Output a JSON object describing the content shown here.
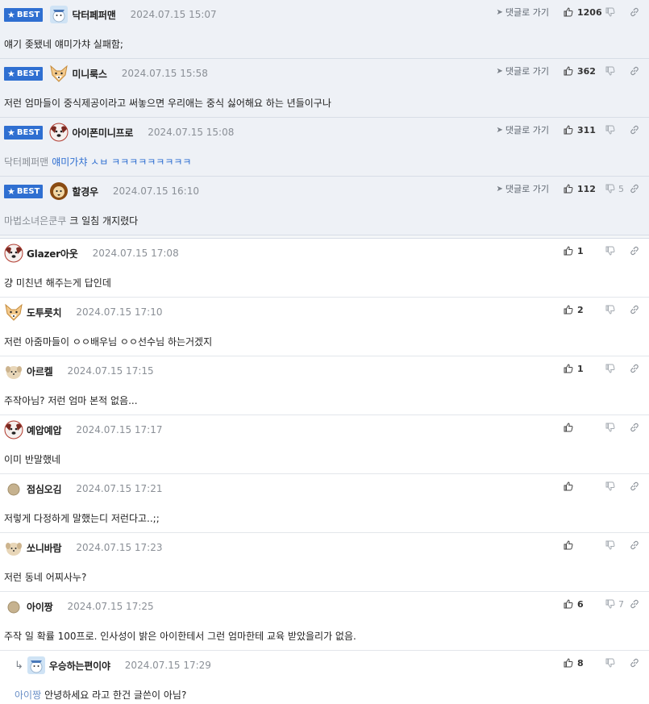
{
  "labels": {
    "best": "BEST",
    "goto": "댓글로 가기"
  },
  "best_comments": [
    {
      "nick": "닥터페퍼맨",
      "date": "2024.07.15 15:07",
      "likes": "1206",
      "dislikes": "",
      "mention": "",
      "text": "얘기 좆됐네 얘미가챠 실패함;",
      "text_style": "normal",
      "avatar": "snowman"
    },
    {
      "nick": "미니룩스",
      "date": "2024.07.15 15:58",
      "likes": "362",
      "dislikes": "",
      "mention": "",
      "text": "저런 엄마들이 중식제공이라고 써놓으면 우리애는 중식 싫어해요 하는 년들이구나",
      "text_style": "normal",
      "avatar": "fox"
    },
    {
      "nick": "아이폰미니프로",
      "date": "2024.07.15 15:08",
      "likes": "311",
      "dislikes": "",
      "mention": "닥터페퍼맨",
      "text": "얘미가챠 ㅅㅂ ㅋㅋㅋㅋㅋㅋㅋㅋㅋ",
      "text_style": "blue",
      "avatar": "dog-red"
    },
    {
      "nick": "할경우",
      "date": "2024.07.15 16:10",
      "likes": "112",
      "dislikes": "5",
      "mention": "마법소녀은쿤쿠",
      "text": "크 일침 개지렸다",
      "text_style": "normal",
      "avatar": "lion"
    }
  ],
  "comments": [
    {
      "nick": "Glazer아웃",
      "date": "2024.07.15 17:08",
      "likes": "1",
      "dislikes": "",
      "mention": "",
      "text": "걍 미친년 해주는게 답인데",
      "avatar": "dog-red",
      "reply": false
    },
    {
      "nick": "도투릇치",
      "date": "2024.07.15 17:10",
      "likes": "2",
      "dislikes": "",
      "mention": "",
      "text": "저런 아줌마들이 ㅇㅇ배우님 ㅇㅇ선수님 하는거겠지",
      "avatar": "fox",
      "reply": false
    },
    {
      "nick": "아르켈",
      "date": "2024.07.15 17:15",
      "likes": "1",
      "dislikes": "",
      "mention": "",
      "text": "주작아님? 저런 엄마 본적 없음...",
      "avatar": "puppy",
      "reply": false
    },
    {
      "nick": "예압예압",
      "date": "2024.07.15 17:17",
      "likes": "",
      "dislikes": "",
      "mention": "",
      "text": "이미 반말했네",
      "avatar": "dog-red",
      "reply": false
    },
    {
      "nick": "점심오김",
      "date": "2024.07.15 17:21",
      "likes": "",
      "dislikes": "",
      "mention": "",
      "text": "저렇게 다정하게 말했는디 저런다고..;;",
      "avatar": "dot",
      "reply": false
    },
    {
      "nick": "쏘니바람",
      "date": "2024.07.15 17:23",
      "likes": "",
      "dislikes": "",
      "mention": "",
      "text": "저런 동네 어찌사누?",
      "avatar": "puppy",
      "reply": false
    },
    {
      "nick": "아이짱",
      "date": "2024.07.15 17:25",
      "likes": "6",
      "dislikes": "7",
      "mention": "",
      "text": "주작 일 확률 100프로. 인사성이 밝은 아이한테서 그런 엄마한테 교육 받았을리가 없음.",
      "avatar": "dot",
      "reply": false
    },
    {
      "nick": "우승하는편이야",
      "date": "2024.07.15 17:29",
      "likes": "8",
      "dislikes": "",
      "mention": "아이짱",
      "text": "안녕하세요 라고 한건 글쓴이 아님?",
      "avatar": "snowman",
      "reply": true
    }
  ]
}
